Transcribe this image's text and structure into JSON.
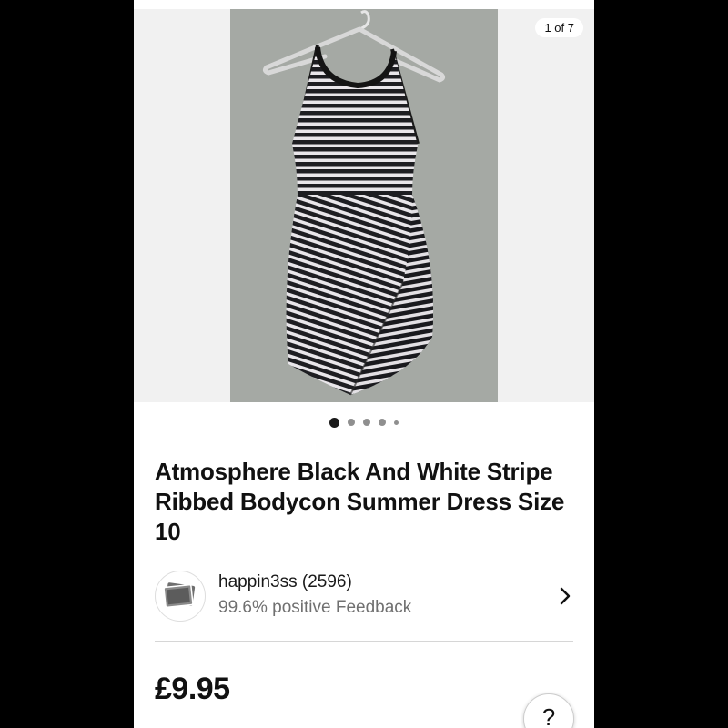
{
  "gallery": {
    "counter": "1 of 7",
    "total_images": 7,
    "active_index": 0,
    "photo_icon": "striped-dress-photo"
  },
  "listing": {
    "title": "Atmosphere Black And White Stripe Ribbed Bodycon Summer Dress Size 10",
    "price": "£9.95"
  },
  "seller": {
    "name": "happin3ss (2596)",
    "feedback": "99.6% positive Feedback",
    "avatar_icon": "seller-avatar-photo"
  },
  "help": {
    "label": "?"
  },
  "colors": {
    "background": "#000000",
    "text_primary": "#111111",
    "text_secondary": "#707070",
    "dot_active": "#191919",
    "dot_inactive": "#8f8f8f"
  }
}
